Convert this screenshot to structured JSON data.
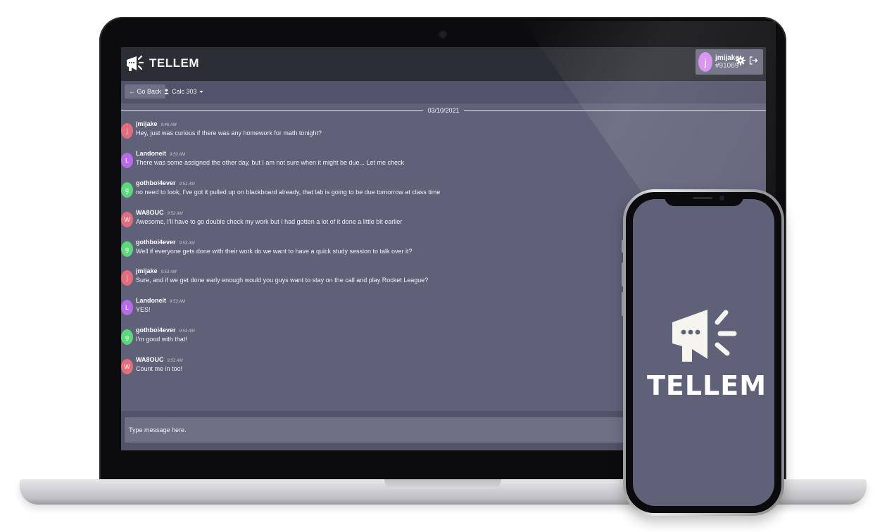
{
  "app": {
    "name": "TELLEM"
  },
  "header": {
    "user": {
      "avatar_initial": "j",
      "name": "jmijake",
      "id": "#91069"
    },
    "icons": {
      "settings": "gear-icon",
      "logout": "logout-icon"
    }
  },
  "channel_bar": {
    "back_label": "← Go Back",
    "channel_name": "Calc 303",
    "channel_icon": "group-icon"
  },
  "date_divider": "03/10/2021",
  "messages": [
    {
      "initial": "j",
      "color": "#e56d7b",
      "user": "jmijake",
      "time": "9:46 AM",
      "text": "Hey, just was curious if there was any homework for math tonight?"
    },
    {
      "initial": "L",
      "color": "#b86be8",
      "user": "Landoneit",
      "time": "9:50 AM",
      "text": "There was some assigned the other day, but I am not sure when it might be due... Let me check"
    },
    {
      "initial": "g",
      "color": "#5bd87a",
      "user": "gothboi4ever",
      "time": "9:51 AM",
      "text": "no need to look, I've got it pulled up on blackboard already, that lab is going to be due tomorrow at class time"
    },
    {
      "initial": "W",
      "color": "#e56d7b",
      "user": "WA8OUC",
      "time": "9:52 AM",
      "text": "Awesome, I'll have to go double check my work but I had gotten a lot of it done a little bit earlier"
    },
    {
      "initial": "g",
      "color": "#5bd87a",
      "user": "gothboi4ever",
      "time": "9:53 AM",
      "text": "Well if everyone gets done with their work do we want to have a quick study session to talk over it?"
    },
    {
      "initial": "j",
      "color": "#e56d7b",
      "user": "jmijake",
      "time": "9:53 AM",
      "text": "Sure, and if we get done early enough would you guys want to stay on the call and play Rocket League?"
    },
    {
      "initial": "L",
      "color": "#b86be8",
      "user": "Landoneit",
      "time": "9:53 AM",
      "text": "YES!"
    },
    {
      "initial": "g",
      "color": "#5bd87a",
      "user": "gothboi4ever",
      "time": "9:53 AM",
      "text": "I'm good with that!"
    },
    {
      "initial": "W",
      "color": "#e56d7b",
      "user": "WA8OUC",
      "time": "9:53 AM",
      "text": "Count me in too!"
    }
  ],
  "composer": {
    "placeholder": "Type message here."
  },
  "phone": {
    "brand": "TELLEM"
  },
  "colors": {
    "screen_bg": "#5f6179",
    "header_bg": "#2c2e35",
    "bar_bg": "#51536a",
    "accent_purple": "#d78cf0"
  }
}
